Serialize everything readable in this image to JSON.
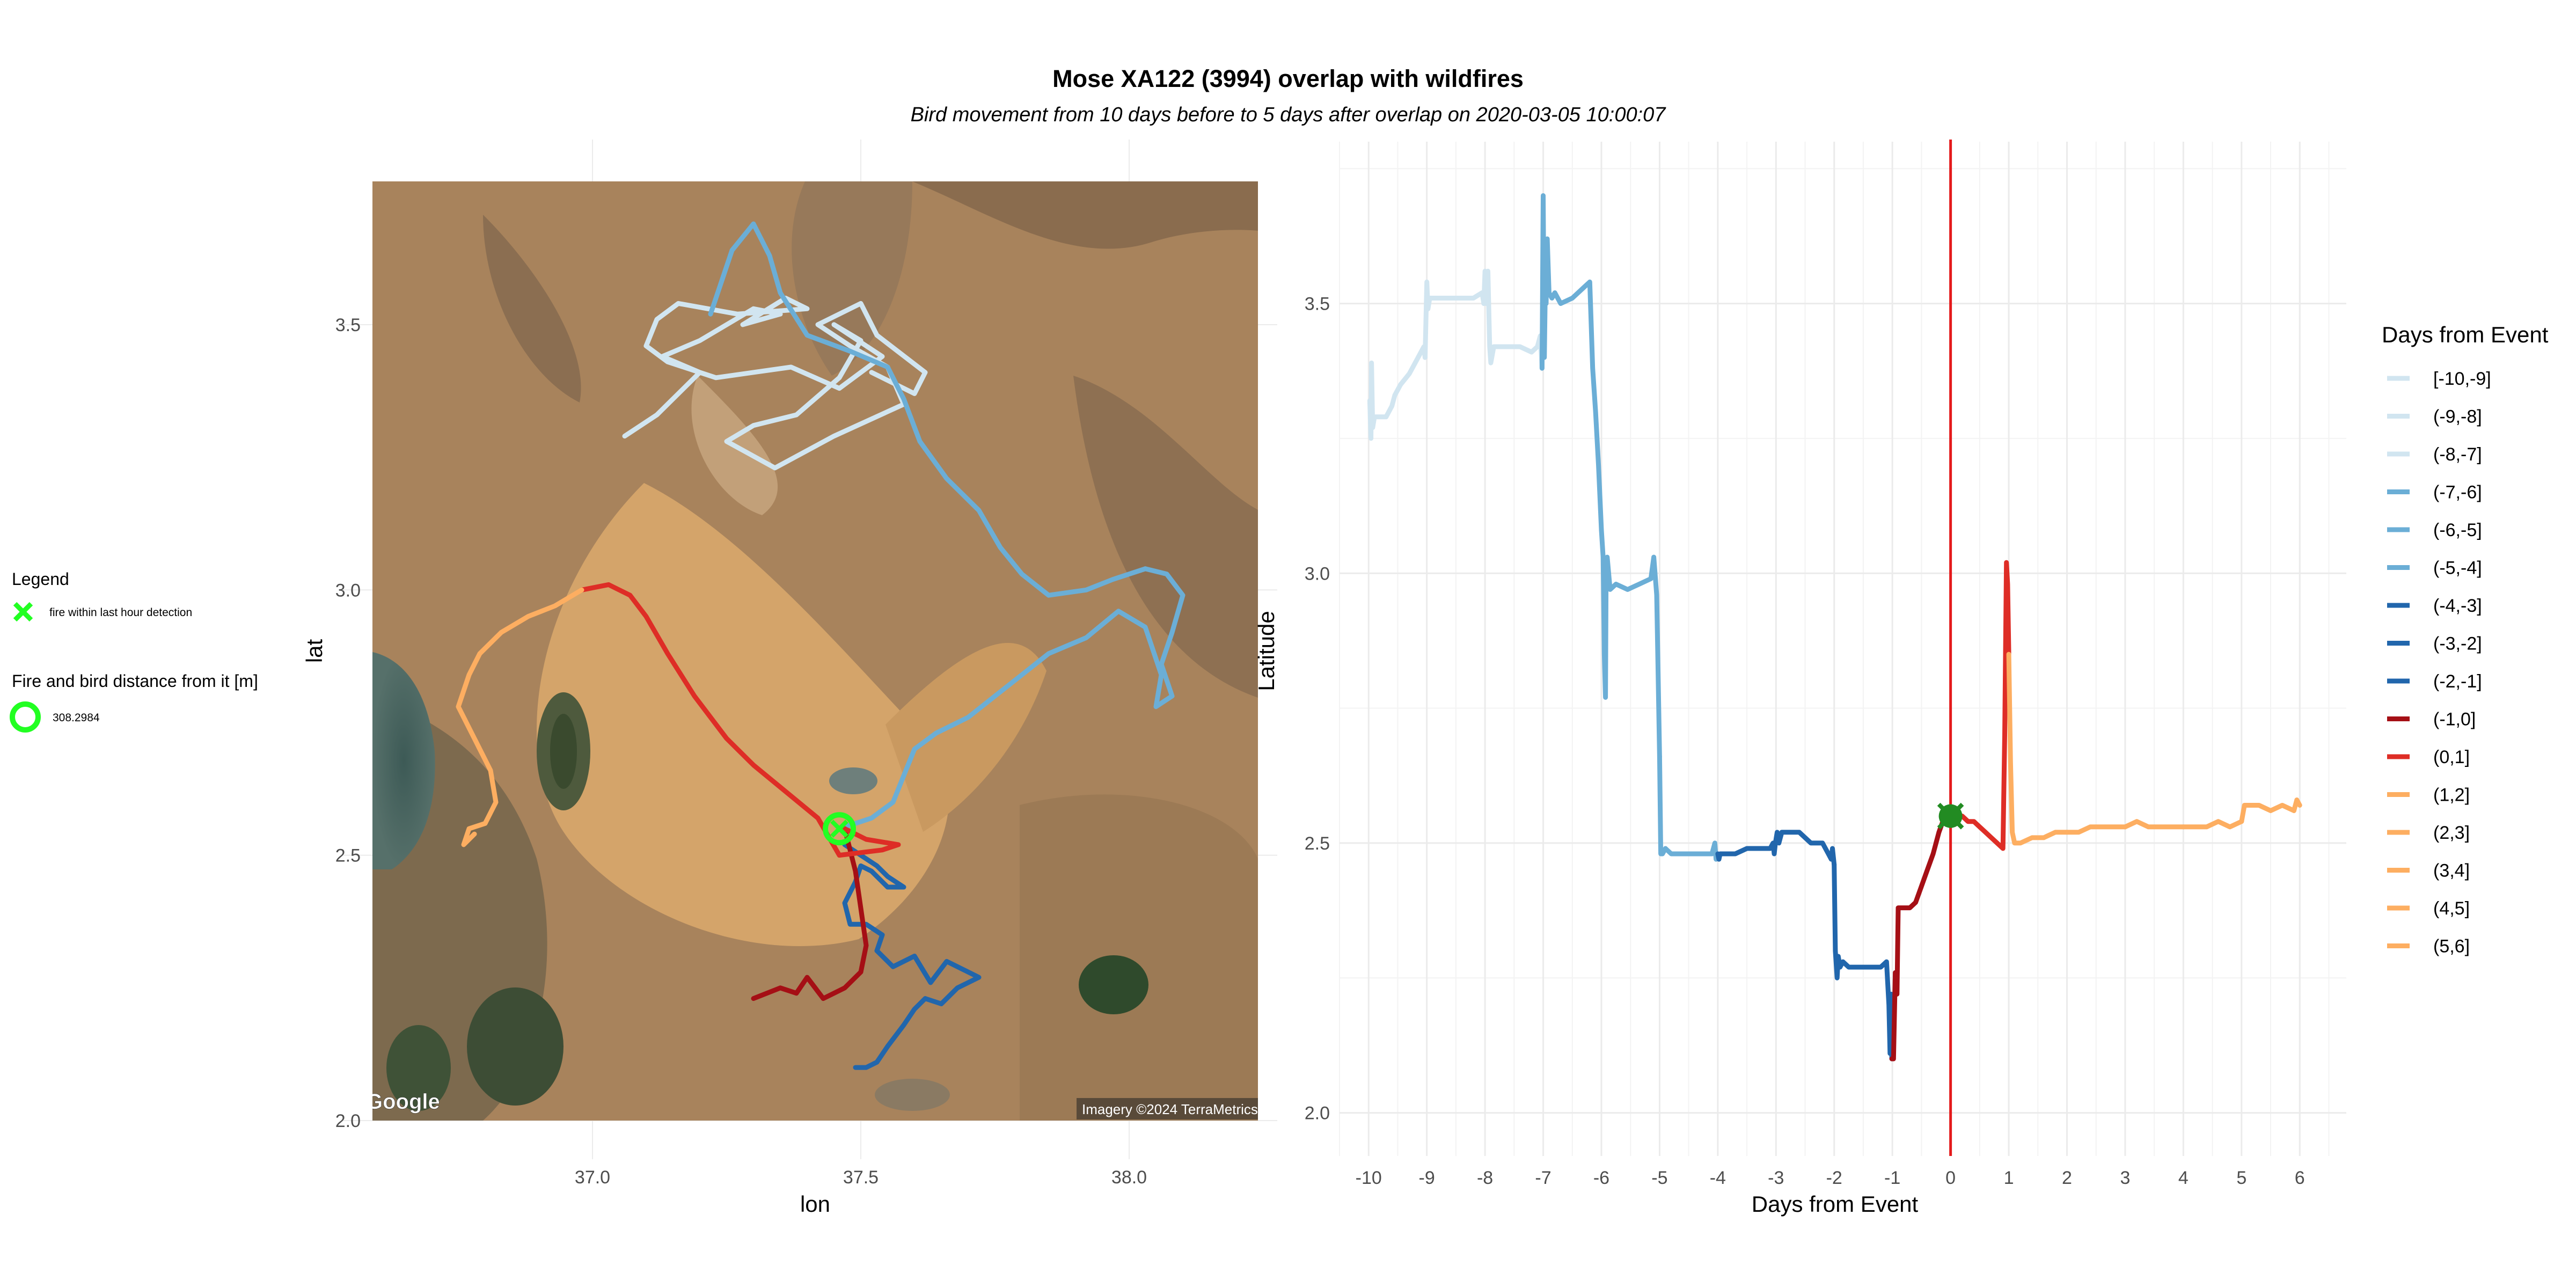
{
  "title": "Mose XA122 (3994) overlap with wildfires",
  "subtitle": "Bird movement from 10 days before to 5 days after overlap on 2020-03-05 10:00:07",
  "left_legend": {
    "legend_title": "Legend",
    "fire_label": "fire within last hour detection",
    "distance_title": "Fire and bird distance from it [m]",
    "distance_value": "308.2984",
    "marker_color": "#22ff22"
  },
  "map_panel": {
    "xlabel": "lon",
    "ylabel": "lat",
    "xticks": [
      "37.0",
      "37.5",
      "38.0"
    ],
    "yticks": [
      "2.0",
      "2.5",
      "3.0",
      "3.5"
    ],
    "google_mark": "Google",
    "attribution": "Imagery ©2024 TerraMetrics"
  },
  "chart_data": [
    {
      "type": "line",
      "panel": "map",
      "xlabel": "lon",
      "ylabel": "lat",
      "xlim": [
        36.59,
        38.24
      ],
      "ylim": [
        2.0,
        3.77
      ],
      "series": [
        {
          "group": "[-10,-9]",
          "color": "#d1e5f0",
          "x": [
            37.06,
            37.12,
            37.2,
            37.13,
            37.2,
            37.3,
            37.35,
            37.28,
            37.36,
            37.4,
            37.27,
            37.16,
            37.12,
            37.1,
            37.14,
            37.23,
            37.37,
            37.46,
            37.54,
            37.45
          ],
          "y": [
            3.29,
            3.33,
            3.41,
            3.44,
            3.47,
            3.53,
            3.52,
            3.5,
            3.55,
            3.53,
            3.52,
            3.54,
            3.51,
            3.46,
            3.43,
            3.4,
            3.42,
            3.38,
            3.44,
            3.5
          ]
        },
        {
          "group": "(-9,-8]",
          "color": "#d1e5f0",
          "x": [
            37.45,
            37.5,
            37.46,
            37.38,
            37.3,
            37.25,
            37.34,
            37.45,
            37.58
          ],
          "y": [
            3.5,
            3.47,
            3.4,
            3.33,
            3.31,
            3.28,
            3.23,
            3.29,
            3.35
          ]
        },
        {
          "group": "(-8,-7]",
          "color": "#d1e5f0",
          "x": [
            37.58,
            37.55,
            37.48,
            37.42,
            37.5,
            37.53,
            37.62,
            37.6,
            37.52
          ],
          "y": [
            3.35,
            3.42,
            3.46,
            3.5,
            3.54,
            3.48,
            3.41,
            3.37,
            3.41
          ]
        },
        {
          "group": "(-7,-6]",
          "color": "#6baed6",
          "x": [
            37.22,
            37.24,
            37.26,
            37.3,
            37.33,
            37.35,
            37.4,
            37.48,
            37.55,
            37.58,
            37.61,
            37.66,
            37.72,
            37.76,
            37.8,
            37.85,
            37.92,
            37.97,
            38.03
          ],
          "y": [
            3.52,
            3.58,
            3.64,
            3.69,
            3.63,
            3.56,
            3.48,
            3.45,
            3.42,
            3.36,
            3.28,
            3.21,
            3.15,
            3.08,
            3.03,
            2.99,
            3.0,
            3.02,
            3.04
          ]
        },
        {
          "group": "(-6,-5]",
          "color": "#6baed6",
          "x": [
            38.03,
            38.07,
            38.1,
            38.08,
            38.06,
            38.08,
            38.05,
            38.06,
            38.03,
            37.98,
            37.92,
            37.85,
            37.8,
            37.75
          ],
          "y": [
            3.04,
            3.03,
            2.99,
            2.92,
            2.86,
            2.8,
            2.78,
            2.84,
            2.93,
            2.96,
            2.91,
            2.88,
            2.84,
            2.8
          ]
        },
        {
          "group": "(-5,-4]",
          "color": "#6baed6",
          "x": [
            37.75,
            37.7,
            37.64,
            37.6,
            37.58,
            37.56,
            37.52,
            37.49,
            37.46
          ],
          "y": [
            2.8,
            2.76,
            2.73,
            2.7,
            2.65,
            2.6,
            2.57,
            2.56,
            2.55
          ]
        },
        {
          "group": "(-4,-3]",
          "color": "#2166ac",
          "x": [
            37.47,
            37.5,
            37.53,
            37.55,
            37.58,
            37.55,
            37.52,
            37.5,
            37.49,
            37.47,
            37.48,
            37.51,
            37.54,
            37.53
          ],
          "y": [
            2.52,
            2.5,
            2.48,
            2.46,
            2.44,
            2.44,
            2.47,
            2.48,
            2.45,
            2.41,
            2.37,
            2.37,
            2.35,
            2.32
          ]
        },
        {
          "group": "(-3,-2]",
          "color": "#2166ac",
          "x": [
            37.53,
            37.56,
            37.6,
            37.63,
            37.66,
            37.7,
            37.72,
            37.68,
            37.65,
            37.62
          ],
          "y": [
            2.32,
            2.29,
            2.31,
            2.26,
            2.3,
            2.28,
            2.27,
            2.25,
            2.22,
            2.23
          ]
        },
        {
          "group": "(-2,-1]",
          "color": "#2166ac",
          "x": [
            37.62,
            37.6,
            37.58,
            37.55,
            37.53,
            37.51,
            37.49
          ],
          "y": [
            2.23,
            2.21,
            2.18,
            2.14,
            2.11,
            2.1,
            2.1
          ]
        },
        {
          "group": "(-1,0]",
          "color": "#a50f15",
          "x": [
            37.3,
            37.35,
            37.38,
            37.4,
            37.43,
            37.47,
            37.5,
            37.51,
            37.5,
            37.49,
            37.47
          ],
          "y": [
            2.23,
            2.25,
            2.24,
            2.27,
            2.23,
            2.25,
            2.28,
            2.33,
            2.4,
            2.47,
            2.55
          ]
        },
        {
          "group": "(0,1]",
          "color": "#de2d26",
          "x": [
            37.47,
            37.51,
            37.57,
            37.54,
            37.46,
            37.42,
            37.36,
            37.3,
            37.25,
            37.19,
            37.14,
            37.1,
            37.07,
            37.03,
            36.98
          ],
          "y": [
            2.55,
            2.53,
            2.52,
            2.51,
            2.5,
            2.57,
            2.62,
            2.67,
            2.72,
            2.8,
            2.88,
            2.95,
            2.99,
            3.01,
            3.0
          ]
        },
        {
          "group": "(1,2]",
          "color": "#fdae61",
          "x": [
            36.98,
            36.93,
            36.88,
            36.83,
            36.79,
            36.77,
            36.75,
            36.78,
            36.81,
            36.82,
            36.8,
            36.77,
            36.76,
            36.78
          ],
          "y": [
            3.0,
            2.97,
            2.95,
            2.92,
            2.88,
            2.84,
            2.78,
            2.72,
            2.66,
            2.6,
            2.56,
            2.55,
            2.52,
            2.54
          ]
        }
      ],
      "fire_point": {
        "lon": 37.46,
        "lat": 2.55
      }
    },
    {
      "type": "line",
      "panel": "timeline",
      "xlabel": "Days from Event",
      "ylabel": "Latitude",
      "xlim": [
        -10.5,
        6.8
      ],
      "ylim": [
        1.92,
        3.8
      ],
      "xticks": [
        "-10",
        "-9",
        "-8",
        "-7",
        "-6",
        "-5",
        "-4",
        "-3",
        "-2",
        "-1",
        "0",
        "1",
        "2",
        "3",
        "4",
        "5",
        "6"
      ],
      "yticks": [
        "2.0",
        "2.5",
        "3.0",
        "3.5"
      ],
      "event_line_x": 0,
      "event_line_color": "#e41a1c",
      "series": [
        {
          "group": "[-10,-9]",
          "color": "#d1e5f0",
          "x": [
            -9.98,
            -9.96,
            -9.95,
            -9.93,
            -9.9,
            -9.8,
            -9.7,
            -9.6,
            -9.55,
            -9.45,
            -9.3,
            -9.15,
            -9.05,
            -9.03
          ],
          "y": [
            3.32,
            3.25,
            3.39,
            3.27,
            3.29,
            3.29,
            3.29,
            3.31,
            3.33,
            3.35,
            3.37,
            3.4,
            3.42,
            3.4
          ]
        },
        {
          "group": "(-9,-8]",
          "color": "#d1e5f0",
          "x": [
            -9.03,
            -9.0,
            -8.98,
            -8.95,
            -8.9,
            -8.8,
            -8.6,
            -8.4,
            -8.2,
            -8.05,
            -8.02
          ],
          "y": [
            3.4,
            3.54,
            3.49,
            3.51,
            3.51,
            3.51,
            3.51,
            3.51,
            3.51,
            3.52,
            3.5
          ]
        },
        {
          "group": "(-8,-7]",
          "color": "#d1e5f0",
          "x": [
            -8.02,
            -8.0,
            -7.98,
            -7.95,
            -7.92,
            -7.9,
            -7.85,
            -7.6,
            -7.4,
            -7.2,
            -7.1,
            -7.05,
            -7.02
          ],
          "y": [
            3.5,
            3.56,
            3.5,
            3.56,
            3.42,
            3.39,
            3.42,
            3.42,
            3.42,
            3.41,
            3.42,
            3.44,
            3.38
          ]
        },
        {
          "group": "(-7,-6]",
          "color": "#6baed6",
          "x": [
            -7.02,
            -7.0,
            -6.98,
            -6.96,
            -6.95,
            -6.93,
            -6.9,
            -6.85,
            -6.8,
            -6.7,
            -6.5,
            -6.3,
            -6.2,
            -6.15,
            -6.1,
            -6.05,
            -6.0
          ],
          "y": [
            3.38,
            3.7,
            3.4,
            3.56,
            3.5,
            3.62,
            3.52,
            3.51,
            3.52,
            3.5,
            3.51,
            3.53,
            3.54,
            3.38,
            3.3,
            3.2,
            3.08
          ]
        },
        {
          "group": "(-6,-5]",
          "color": "#6baed6",
          "x": [
            -6.0,
            -5.97,
            -5.95,
            -5.93,
            -5.92,
            -5.9,
            -5.85,
            -5.75,
            -5.55,
            -5.35,
            -5.15,
            -5.1,
            -5.05,
            -5.03,
            -5.0
          ],
          "y": [
            3.08,
            3.03,
            2.85,
            2.77,
            2.99,
            3.03,
            2.97,
            2.98,
            2.97,
            2.98,
            2.99,
            3.03,
            2.96,
            2.84,
            2.66
          ]
        },
        {
          "group": "(-5,-4]",
          "color": "#6baed6",
          "x": [
            -5.0,
            -4.98,
            -4.95,
            -4.9,
            -4.8,
            -4.6,
            -4.4,
            -4.2,
            -4.1,
            -4.05,
            -4.03,
            -4.0
          ],
          "y": [
            2.66,
            2.48,
            2.48,
            2.49,
            2.48,
            2.48,
            2.48,
            2.48,
            2.48,
            2.5,
            2.47,
            2.48
          ]
        },
        {
          "group": "(-4,-3]",
          "color": "#2166ac",
          "x": [
            -4.0,
            -3.98,
            -3.96,
            -3.9,
            -3.7,
            -3.5,
            -3.3,
            -3.1,
            -3.05,
            -3.03,
            -3.01
          ],
          "y": [
            2.48,
            2.47,
            2.48,
            2.48,
            2.48,
            2.49,
            2.49,
            2.49,
            2.5,
            2.48,
            2.5
          ]
        },
        {
          "group": "(-3,-2]",
          "color": "#2166ac",
          "x": [
            -3.01,
            -2.98,
            -2.95,
            -2.9,
            -2.8,
            -2.6,
            -2.4,
            -2.2,
            -2.1,
            -2.05,
            -2.03,
            -2.0
          ],
          "y": [
            2.5,
            2.52,
            2.5,
            2.52,
            2.52,
            2.52,
            2.5,
            2.5,
            2.48,
            2.47,
            2.49,
            2.46
          ]
        },
        {
          "group": "(-2,-1]",
          "color": "#2166ac",
          "x": [
            -2.0,
            -1.98,
            -1.95,
            -1.93,
            -1.9,
            -1.85,
            -1.75,
            -1.55,
            -1.35,
            -1.2,
            -1.1,
            -1.06,
            -1.04,
            -1.02,
            -1.01
          ],
          "y": [
            2.46,
            2.3,
            2.25,
            2.29,
            2.27,
            2.28,
            2.27,
            2.27,
            2.27,
            2.27,
            2.28,
            2.2,
            2.11,
            2.22,
            2.1
          ]
        },
        {
          "group": "(-1,0]",
          "color": "#a50f15",
          "x": [
            -1.01,
            -0.98,
            -0.95,
            -0.92,
            -0.9,
            -0.85,
            -0.8,
            -0.7,
            -0.6,
            -0.5,
            -0.4,
            -0.3,
            -0.2,
            -0.1,
            -0.02
          ],
          "y": [
            2.1,
            2.1,
            2.26,
            2.22,
            2.38,
            2.38,
            2.38,
            2.38,
            2.39,
            2.42,
            2.45,
            2.48,
            2.52,
            2.55,
            2.56
          ]
        },
        {
          "group": "(0,1]",
          "color": "#de2d26",
          "x": [
            0.0,
            0.1,
            0.2,
            0.3,
            0.4,
            0.5,
            0.6,
            0.7,
            0.8,
            0.9,
            0.93,
            0.96,
            0.98,
            1.0
          ],
          "y": [
            2.55,
            2.55,
            2.55,
            2.54,
            2.54,
            2.53,
            2.52,
            2.51,
            2.5,
            2.49,
            2.7,
            3.02,
            2.98,
            2.85
          ]
        },
        {
          "group": "(1,2]",
          "color": "#fdae61",
          "x": [
            1.0,
            1.03,
            1.06,
            1.1,
            1.2,
            1.4,
            1.6,
            1.8,
            1.95,
            2.0
          ],
          "y": [
            2.85,
            2.65,
            2.52,
            2.5,
            2.5,
            2.51,
            2.51,
            2.52,
            2.52,
            2.52
          ]
        },
        {
          "group": "(2,3]",
          "color": "#fdae61",
          "x": [
            2.0,
            2.2,
            2.4,
            2.6,
            2.8,
            3.0
          ],
          "y": [
            2.52,
            2.52,
            2.53,
            2.53,
            2.53,
            2.53
          ]
        },
        {
          "group": "(3,4]",
          "color": "#fdae61",
          "x": [
            3.0,
            3.2,
            3.4,
            3.6,
            3.8,
            4.0
          ],
          "y": [
            2.53,
            2.54,
            2.53,
            2.53,
            2.53,
            2.53
          ]
        },
        {
          "group": "(4,5]",
          "color": "#fdae61",
          "x": [
            4.0,
            4.2,
            4.4,
            4.6,
            4.8,
            5.0
          ],
          "y": [
            2.53,
            2.53,
            2.53,
            2.54,
            2.53,
            2.54
          ]
        },
        {
          "group": "(5,6]",
          "color": "#fdae61",
          "x": [
            5.0,
            5.05,
            5.1,
            5.3,
            5.5,
            5.7,
            5.9,
            5.95,
            6.0
          ],
          "y": [
            2.54,
            2.57,
            2.57,
            2.57,
            2.56,
            2.57,
            2.56,
            2.58,
            2.57
          ]
        }
      ],
      "event_marker": {
        "x": 0,
        "y": 2.55,
        "color": "#228b22"
      }
    }
  ],
  "right_legend": {
    "title": "Days from Event",
    "items": [
      {
        "label": "[-10,-9]",
        "color": "#d1e5f0"
      },
      {
        "label": "(-9,-8]",
        "color": "#d1e5f0"
      },
      {
        "label": "(-8,-7]",
        "color": "#d1e5f0"
      },
      {
        "label": "(-7,-6]",
        "color": "#6baed6"
      },
      {
        "label": "(-6,-5]",
        "color": "#6baed6"
      },
      {
        "label": "(-5,-4]",
        "color": "#6baed6"
      },
      {
        "label": "(-4,-3]",
        "color": "#2166ac"
      },
      {
        "label": "(-3,-2]",
        "color": "#2166ac"
      },
      {
        "label": "(-2,-1]",
        "color": "#2166ac"
      },
      {
        "label": "(-1,0]",
        "color": "#a50f15"
      },
      {
        "label": "(0,1]",
        "color": "#de2d26"
      },
      {
        "label": "(1,2]",
        "color": "#fdae61"
      },
      {
        "label": "(2,3]",
        "color": "#fdae61"
      },
      {
        "label": "(3,4]",
        "color": "#fdae61"
      },
      {
        "label": "(4,5]",
        "color": "#fdae61"
      },
      {
        "label": "(5,6]",
        "color": "#fdae61"
      }
    ]
  }
}
